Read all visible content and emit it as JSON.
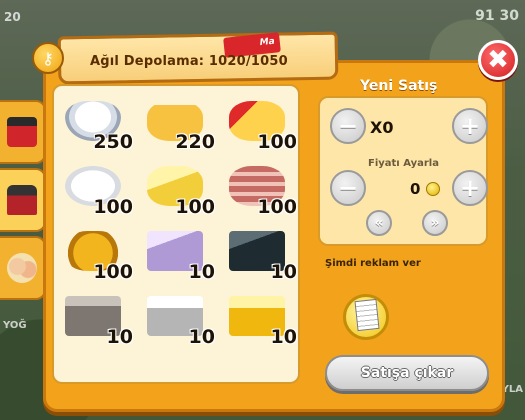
{
  "hud": {
    "top_right_value": "91 30",
    "top_left_value": "20"
  },
  "edge_labels": {
    "left": "YOĞ",
    "right": "OYLA"
  },
  "storage": {
    "title": "Ağıl Depolama: 1020/1050",
    "tag": "Ma",
    "items": [
      {
        "name": "cream",
        "qty": "250"
      },
      {
        "name": "oil",
        "qty": "220"
      },
      {
        "name": "cheese",
        "qty": "100"
      },
      {
        "name": "goat-cheese",
        "qty": "100"
      },
      {
        "name": "butter",
        "qty": "100"
      },
      {
        "name": "bacon",
        "qty": "100"
      },
      {
        "name": "honey-pot",
        "qty": "100"
      },
      {
        "name": "silver-ore",
        "qty": "10"
      },
      {
        "name": "coal",
        "qty": "10"
      },
      {
        "name": "iron-bar",
        "qty": "10"
      },
      {
        "name": "silver-bar",
        "qty": "10"
      },
      {
        "name": "gold-bar",
        "qty": "10"
      }
    ]
  },
  "sale": {
    "title": "Yeni Satış",
    "quantity": "X0",
    "price_label": "Fiyatı Ayarla",
    "price": "0",
    "ad_label": "Şimdi reklam ver",
    "sell_button": "Satışa çıkar"
  },
  "colors": {
    "panel": "#f2a31b",
    "panel_border": "#c9780d",
    "grid_bg": "#fdf3d7",
    "close_red": "#d21f22"
  }
}
